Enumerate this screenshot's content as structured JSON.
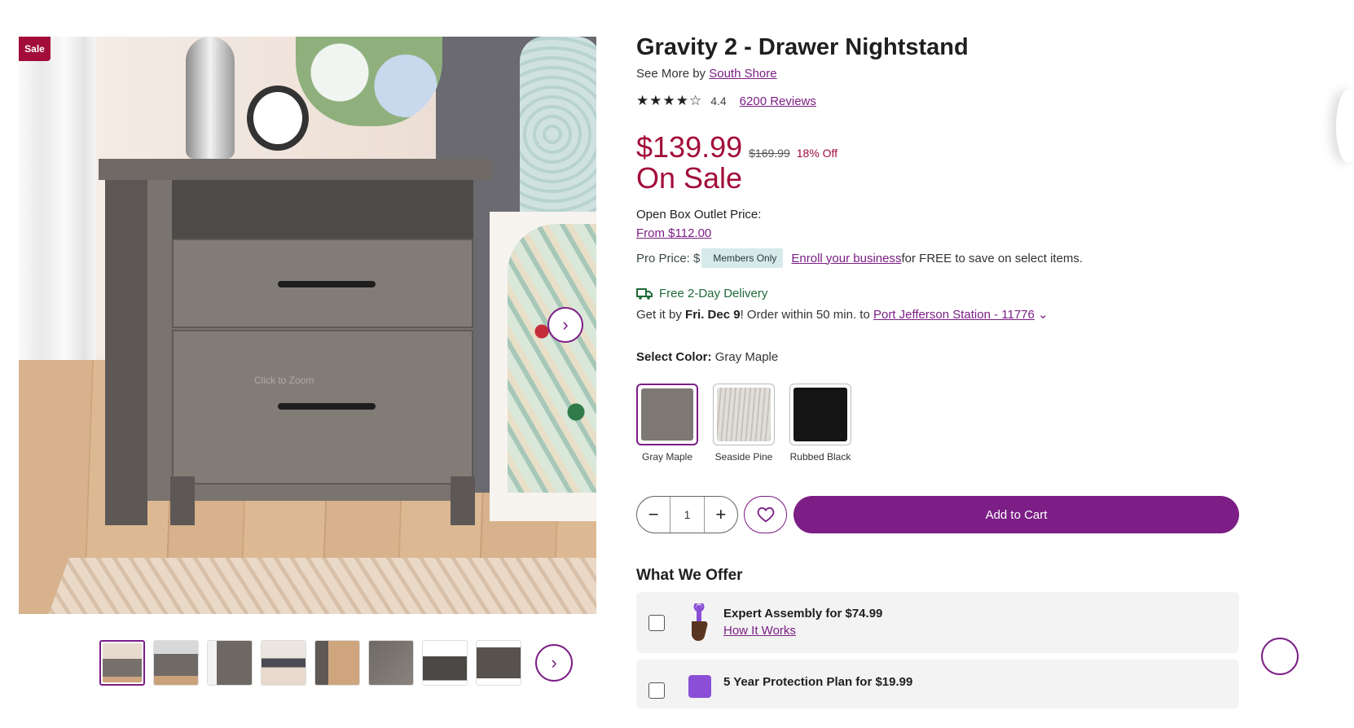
{
  "gallery": {
    "sale_badge": "Sale",
    "zoom_hint": "Click to Zoom",
    "thumb_count": 8
  },
  "product": {
    "title": "Gravity 2 - Drawer Nightstand",
    "see_more_prefix": "See More by ",
    "brand": "South Shore",
    "rating": "4.4",
    "rating_stars": 4.4,
    "reviews": "6200 Reviews"
  },
  "pricing": {
    "current": "$139.99",
    "was": "$169.99",
    "off": "18% Off",
    "sale_label": "On Sale",
    "outlet_label": "Open Box Outlet Price:",
    "outlet_link": "From $112.00",
    "pro_label": "Pro Price:",
    "pro_dollar": "$",
    "members_only": "Members Only",
    "enroll_link": "Enroll your business",
    "enroll_rest": " for FREE to save on select items."
  },
  "delivery": {
    "headline": "Free 2-Day Delivery",
    "prefix": "Get it by ",
    "date": "Fri. Dec 9",
    "middle": "! Order within 50 min. to ",
    "location": "Port Jefferson Station - 11776"
  },
  "color": {
    "label": "Select Color:",
    "selected": "Gray Maple",
    "options": [
      {
        "name": "Gray Maple",
        "color": "#7d7873"
      },
      {
        "name": "Seaside Pine",
        "color": "#d9d6d0"
      },
      {
        "name": "Rubbed Black",
        "color": "#141414"
      }
    ]
  },
  "cart": {
    "minus": "−",
    "quantity": "1",
    "plus": "+",
    "add_to_cart": "Add to Cart"
  },
  "offer": {
    "title": "What We Offer",
    "items": [
      {
        "title": "Expert Assembly for $74.99",
        "link": "How It Works"
      },
      {
        "title": "5 Year Protection Plan for $19.99"
      }
    ]
  },
  "colors": {
    "accent": "#7c1e86",
    "sale": "#a30d3a",
    "delivery_green": "#1f6b3a"
  }
}
